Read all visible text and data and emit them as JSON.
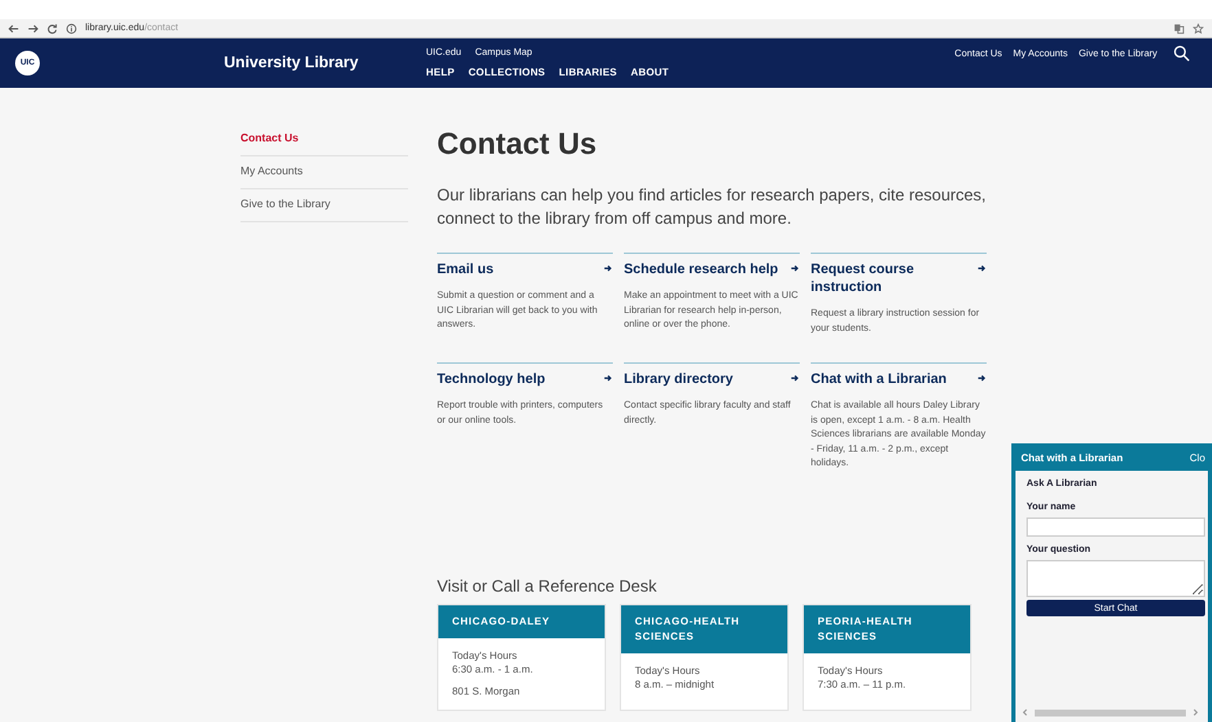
{
  "browser": {
    "url_host": "library.uic.edu",
    "url_path": "/contact"
  },
  "header": {
    "logo": "UIC",
    "site_title": "University Library",
    "utility_links": [
      "UIC.edu",
      "Campus Map"
    ],
    "main_nav": [
      "HELP",
      "COLLECTIONS",
      "LIBRARIES",
      "ABOUT"
    ],
    "right_links": [
      "Contact Us",
      "My Accounts",
      "Give to the Library"
    ]
  },
  "sidebar": {
    "items": [
      {
        "label": "Contact Us",
        "selected": true
      },
      {
        "label": "My Accounts",
        "selected": false
      },
      {
        "label": "Give to the Library",
        "selected": false
      }
    ]
  },
  "page": {
    "title": "Contact Us",
    "intro": "Our librarians can help you find articles for research papers, cite resources, connect to the library from off campus and more."
  },
  "services": [
    {
      "title": "Email us",
      "description": "Submit a question or comment and a UIC Librarian will get back to you with answers."
    },
    {
      "title": "Schedule research help",
      "description": "Make an appointment to meet with a UIC Librarian for research help in-person, online or over the phone."
    },
    {
      "title": "Request course instruction",
      "description": "Request a library instruction session for your students."
    },
    {
      "title": "Technology help",
      "description": "Report trouble with printers, computers or our online tools."
    },
    {
      "title": "Library directory",
      "description": "Contact specific library faculty and staff directly."
    },
    {
      "title": "Chat with a Librarian",
      "description": "Chat is available all hours Daley Library is open, except 1 a.m. - 8 a.m. Health Sciences librarians are available Monday - Friday, 11 a.m. - 2 p.m., except holidays."
    }
  ],
  "reference": {
    "heading": "Visit or Call a Reference Desk",
    "desks": [
      {
        "name": "CHICAGO-DALEY",
        "hours_label": "Today's Hours",
        "hours": "6:30 a.m. - 1 a.m.",
        "address": "801 S. Morgan"
      },
      {
        "name": "CHICAGO-HEALTH SCIENCES",
        "hours_label": "Today's Hours",
        "hours": "8 a.m. – midnight"
      },
      {
        "name": "PEORIA-HEALTH SCIENCES",
        "hours_label": "Today's Hours",
        "hours": "7:30 a.m. – 11 p.m."
      }
    ]
  },
  "chat": {
    "title": "Chat with a Librarian",
    "close_label": "Clo",
    "subtitle": "Ask A Librarian",
    "fields": [
      {
        "label": "Your name",
        "kind": "text"
      },
      {
        "label": "Your question",
        "kind": "textarea"
      }
    ],
    "button": "Start Chat"
  }
}
